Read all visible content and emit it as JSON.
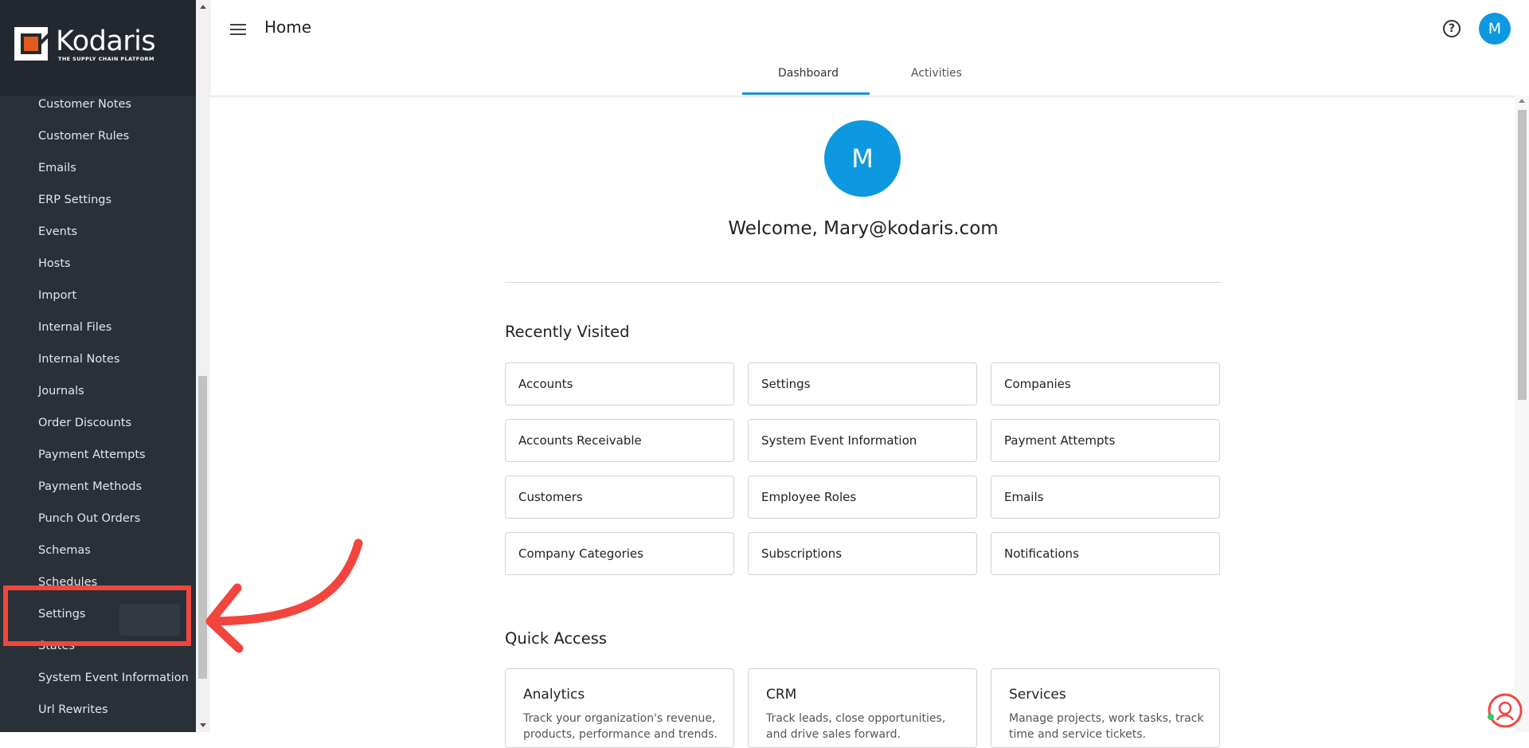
{
  "brand": {
    "name": "Kodaris",
    "tagline": "THE SUPPLY CHAIN PLATFORM",
    "mark_colors": {
      "outer": "#ffffff",
      "inner": "#e35a1d"
    }
  },
  "sidebar": {
    "items": [
      {
        "label": "Customer Notes"
      },
      {
        "label": "Customer Rules"
      },
      {
        "label": "Emails"
      },
      {
        "label": "ERP Settings"
      },
      {
        "label": "Events"
      },
      {
        "label": "Hosts"
      },
      {
        "label": "Import"
      },
      {
        "label": "Internal Files"
      },
      {
        "label": "Internal Notes"
      },
      {
        "label": "Journals"
      },
      {
        "label": "Order Discounts"
      },
      {
        "label": "Payment Attempts"
      },
      {
        "label": "Payment Methods"
      },
      {
        "label": "Punch Out Orders"
      },
      {
        "label": "Schemas"
      },
      {
        "label": "Schedules"
      },
      {
        "label": "Settings"
      },
      {
        "label": "States"
      },
      {
        "label": "System Event Information"
      },
      {
        "label": "Url Rewrites"
      }
    ],
    "highlighted_item": "Settings"
  },
  "header": {
    "title": "Home",
    "menu_icon": "hamburger-menu-icon",
    "help_icon": "help-circle-icon",
    "help_glyph": "?",
    "avatar_initial": "M",
    "tabs": [
      {
        "label": "Dashboard",
        "active": true
      },
      {
        "label": "Activities",
        "active": false
      }
    ]
  },
  "main": {
    "avatar_initial": "M",
    "welcome": "Welcome, Mary@kodaris.com",
    "recently_visited": {
      "title": "Recently Visited",
      "items": [
        "Accounts",
        "Settings",
        "Companies",
        "Accounts Receivable",
        "System Event Information",
        "Payment Attempts",
        "Customers",
        "Employee Roles",
        "Emails",
        "Company Categories",
        "Subscriptions",
        "Notifications"
      ]
    },
    "quick_access": {
      "title": "Quick Access",
      "items": [
        {
          "title": "Analytics",
          "desc": "Track your organization's revenue, products, performance and trends."
        },
        {
          "title": "CRM",
          "desc": "Track leads, close opportunities, and drive sales forward."
        },
        {
          "title": "Services",
          "desc": "Manage projects, work tasks, track time and service tickets."
        }
      ]
    }
  },
  "colors": {
    "sidebar_bg": "#2a3038",
    "accent_blue": "#0d99e0",
    "tab_indicator": "#1a8fd8",
    "annotation_red": "#f2453d"
  },
  "annotation": {
    "highlight_box": "red-rectangle-around-settings",
    "arrow": "red-curved-arrow-icon"
  },
  "chat_widget": {
    "icon": "chat-support-icon",
    "status_color": "#2ecc71"
  }
}
